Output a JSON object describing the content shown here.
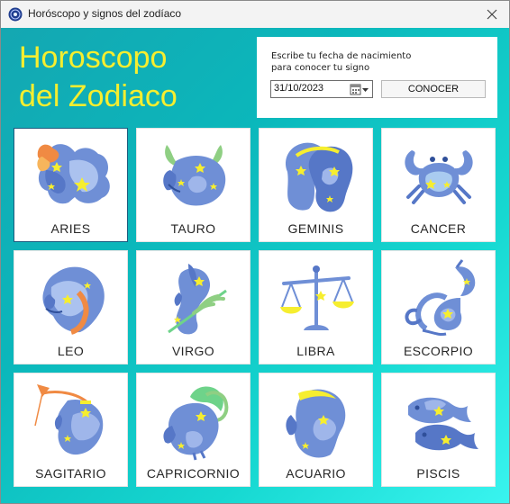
{
  "window": {
    "title": "Horóscopo y signos del zodíaco"
  },
  "header": {
    "title_line1": "Horoscopo",
    "title_line2": "del Zodiaco"
  },
  "form": {
    "instructions_line1": "Escribe tu fecha de nacimiento",
    "instructions_line2": "para conocer tu signo",
    "date_value": "31/10/2023",
    "submit_label": "CONOCER"
  },
  "signs": [
    {
      "name": "ARIES",
      "icon": "aries-icon"
    },
    {
      "name": "TAURO",
      "icon": "taurus-icon"
    },
    {
      "name": "GEMINIS",
      "icon": "gemini-icon"
    },
    {
      "name": "CANCER",
      "icon": "cancer-icon"
    },
    {
      "name": "LEO",
      "icon": "leo-icon"
    },
    {
      "name": "VIRGO",
      "icon": "virgo-icon"
    },
    {
      "name": "LIBRA",
      "icon": "libra-icon"
    },
    {
      "name": "ESCORPIO",
      "icon": "scorpio-icon"
    },
    {
      "name": "SAGITARIO",
      "icon": "sagittarius-icon"
    },
    {
      "name": "CAPRICORNIO",
      "icon": "capricorn-icon"
    },
    {
      "name": "ACUARIO",
      "icon": "aquarius-icon"
    },
    {
      "name": "PISCIS",
      "icon": "pisces-icon"
    }
  ],
  "colors": {
    "title": "#f6ee2f",
    "background_start": "#14a7b2",
    "background_end": "#39f4ef",
    "icon_blue": "#6f8fd6",
    "icon_yellow": "#f6ee2f"
  }
}
